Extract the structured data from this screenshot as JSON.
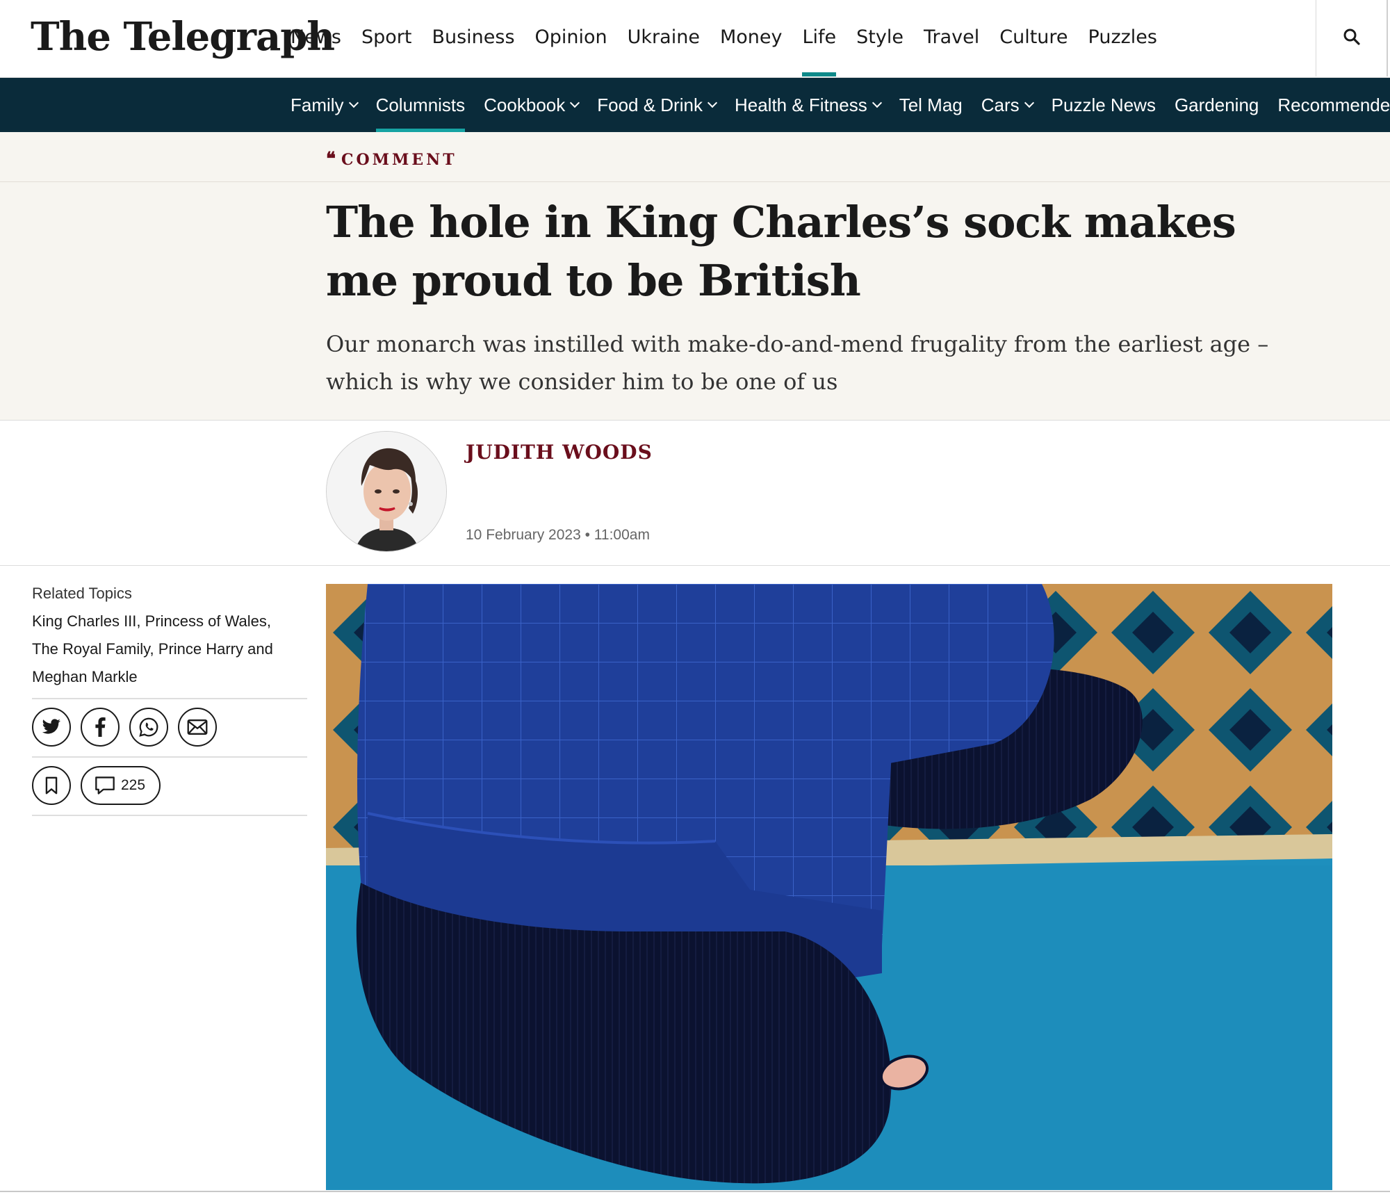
{
  "header": {
    "logo": "The Telegraph",
    "nav": [
      {
        "label": "News",
        "active": false
      },
      {
        "label": "Sport",
        "active": false
      },
      {
        "label": "Business",
        "active": false
      },
      {
        "label": "Opinion",
        "active": false
      },
      {
        "label": "Ukraine",
        "active": false
      },
      {
        "label": "Money",
        "active": false
      },
      {
        "label": "Life",
        "active": true
      },
      {
        "label": "Style",
        "active": false
      },
      {
        "label": "Travel",
        "active": false
      },
      {
        "label": "Culture",
        "active": false
      },
      {
        "label": "Puzzles",
        "active": false
      }
    ],
    "search_icon": "search-icon"
  },
  "subnav": [
    {
      "label": "Family",
      "dropdown": true,
      "active": false
    },
    {
      "label": "Columnists",
      "dropdown": false,
      "active": true
    },
    {
      "label": "Cookbook",
      "dropdown": true,
      "active": false
    },
    {
      "label": "Food & Drink",
      "dropdown": true,
      "active": false
    },
    {
      "label": "Health & Fitness",
      "dropdown": true,
      "active": false
    },
    {
      "label": "Tel Mag",
      "dropdown": false,
      "active": false
    },
    {
      "label": "Cars",
      "dropdown": true,
      "active": false
    },
    {
      "label": "Puzzle News",
      "dropdown": false,
      "active": false
    },
    {
      "label": "Gardening",
      "dropdown": false,
      "active": false
    },
    {
      "label": "Recommended",
      "dropdown": false,
      "active": false
    }
  ],
  "article": {
    "kicker": "COMMENT",
    "headline": "The hole in King Charles’s sock makes me proud to be British",
    "standfirst": "Our monarch was instilled with make-do-and-mend frugality from the earliest age – which is why we consider him to be one of us",
    "author": "JUDITH WOODS",
    "date": "10 February 2023 • 11:00am"
  },
  "sidebar": {
    "related_label": "Related Topics",
    "related_topics": [
      "King Charles III",
      "Princess of Wales",
      "The Royal Family",
      "Prince Harry and Meghan Markle"
    ],
    "share": [
      "twitter-icon",
      "facebook-icon",
      "whatsapp-icon",
      "email-icon"
    ],
    "comment_count": "225"
  },
  "colors": {
    "nav_dark": "#0a2b3a",
    "accent_teal": "#0f8a8a",
    "kicker_maroon": "#6a0e1c",
    "band_bg": "#f7f5f0"
  }
}
